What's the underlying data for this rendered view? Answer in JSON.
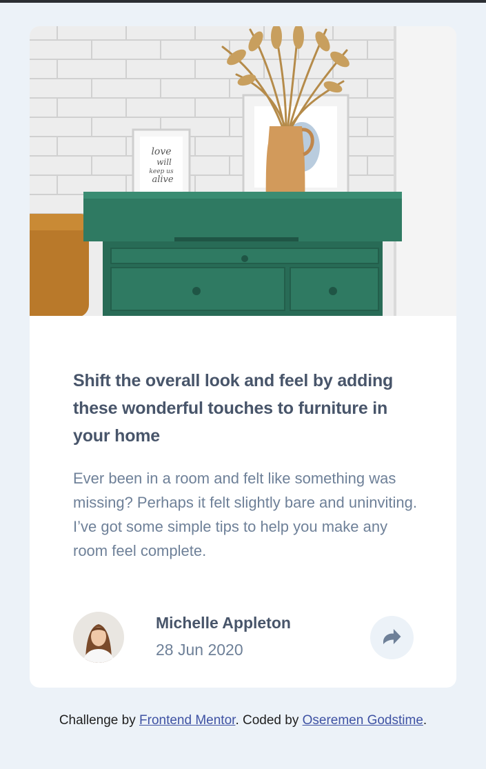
{
  "article": {
    "image_alt": "drawers",
    "title": "Shift the overall look and feel by adding these wonderful touches to furniture in your home",
    "description": "Ever been in a room and felt like something was missing? Perhaps it felt slightly bare and uninviting. I’ve got some simple tips to help you make any room feel complete.",
    "artwork_text": [
      "love",
      "will",
      "keep us",
      "alive"
    ]
  },
  "author": {
    "name": "Michelle Appleton",
    "date": "28 Jun 2020"
  },
  "share": {
    "icon": "share-icon"
  },
  "footer": {
    "prefix": "Challenge by ",
    "link1": "Frontend Mentor",
    "middle": ". Coded by ",
    "link2": "Oseremen Godstime",
    "suffix": "."
  },
  "colors": {
    "background": "#ECF2F8",
    "card": "#FFFFFF",
    "heading": "#48556A",
    "body_text": "#6E8098",
    "link": "#3E52A3",
    "drawer_green": "#2F7A62"
  }
}
